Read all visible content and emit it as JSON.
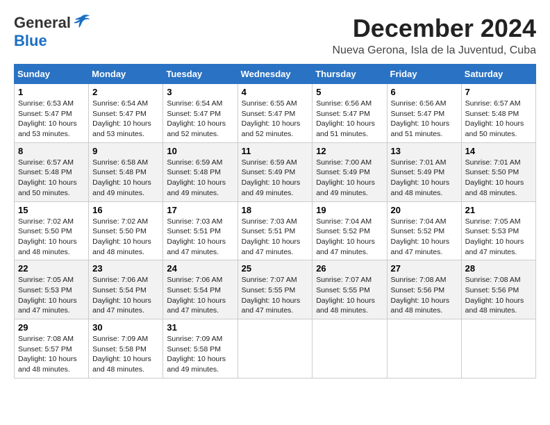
{
  "logo": {
    "general": "General",
    "blue": "Blue"
  },
  "title": "December 2024",
  "location": "Nueva Gerona, Isla de la Juventud, Cuba",
  "weekdays": [
    "Sunday",
    "Monday",
    "Tuesday",
    "Wednesday",
    "Thursday",
    "Friday",
    "Saturday"
  ],
  "weeks": [
    [
      {
        "day": "1",
        "sunrise": "6:53 AM",
        "sunset": "5:47 PM",
        "daylight": "10 hours and 53 minutes."
      },
      {
        "day": "2",
        "sunrise": "6:54 AM",
        "sunset": "5:47 PM",
        "daylight": "10 hours and 53 minutes."
      },
      {
        "day": "3",
        "sunrise": "6:54 AM",
        "sunset": "5:47 PM",
        "daylight": "10 hours and 52 minutes."
      },
      {
        "day": "4",
        "sunrise": "6:55 AM",
        "sunset": "5:47 PM",
        "daylight": "10 hours and 52 minutes."
      },
      {
        "day": "5",
        "sunrise": "6:56 AM",
        "sunset": "5:47 PM",
        "daylight": "10 hours and 51 minutes."
      },
      {
        "day": "6",
        "sunrise": "6:56 AM",
        "sunset": "5:47 PM",
        "daylight": "10 hours and 51 minutes."
      },
      {
        "day": "7",
        "sunrise": "6:57 AM",
        "sunset": "5:48 PM",
        "daylight": "10 hours and 50 minutes."
      }
    ],
    [
      {
        "day": "8",
        "sunrise": "6:57 AM",
        "sunset": "5:48 PM",
        "daylight": "10 hours and 50 minutes."
      },
      {
        "day": "9",
        "sunrise": "6:58 AM",
        "sunset": "5:48 PM",
        "daylight": "10 hours and 49 minutes."
      },
      {
        "day": "10",
        "sunrise": "6:59 AM",
        "sunset": "5:48 PM",
        "daylight": "10 hours and 49 minutes."
      },
      {
        "day": "11",
        "sunrise": "6:59 AM",
        "sunset": "5:49 PM",
        "daylight": "10 hours and 49 minutes."
      },
      {
        "day": "12",
        "sunrise": "7:00 AM",
        "sunset": "5:49 PM",
        "daylight": "10 hours and 49 minutes."
      },
      {
        "day": "13",
        "sunrise": "7:01 AM",
        "sunset": "5:49 PM",
        "daylight": "10 hours and 48 minutes."
      },
      {
        "day": "14",
        "sunrise": "7:01 AM",
        "sunset": "5:50 PM",
        "daylight": "10 hours and 48 minutes."
      }
    ],
    [
      {
        "day": "15",
        "sunrise": "7:02 AM",
        "sunset": "5:50 PM",
        "daylight": "10 hours and 48 minutes."
      },
      {
        "day": "16",
        "sunrise": "7:02 AM",
        "sunset": "5:50 PM",
        "daylight": "10 hours and 48 minutes."
      },
      {
        "day": "17",
        "sunrise": "7:03 AM",
        "sunset": "5:51 PM",
        "daylight": "10 hours and 47 minutes."
      },
      {
        "day": "18",
        "sunrise": "7:03 AM",
        "sunset": "5:51 PM",
        "daylight": "10 hours and 47 minutes."
      },
      {
        "day": "19",
        "sunrise": "7:04 AM",
        "sunset": "5:52 PM",
        "daylight": "10 hours and 47 minutes."
      },
      {
        "day": "20",
        "sunrise": "7:04 AM",
        "sunset": "5:52 PM",
        "daylight": "10 hours and 47 minutes."
      },
      {
        "day": "21",
        "sunrise": "7:05 AM",
        "sunset": "5:53 PM",
        "daylight": "10 hours and 47 minutes."
      }
    ],
    [
      {
        "day": "22",
        "sunrise": "7:05 AM",
        "sunset": "5:53 PM",
        "daylight": "10 hours and 47 minutes."
      },
      {
        "day": "23",
        "sunrise": "7:06 AM",
        "sunset": "5:54 PM",
        "daylight": "10 hours and 47 minutes."
      },
      {
        "day": "24",
        "sunrise": "7:06 AM",
        "sunset": "5:54 PM",
        "daylight": "10 hours and 47 minutes."
      },
      {
        "day": "25",
        "sunrise": "7:07 AM",
        "sunset": "5:55 PM",
        "daylight": "10 hours and 47 minutes."
      },
      {
        "day": "26",
        "sunrise": "7:07 AM",
        "sunset": "5:55 PM",
        "daylight": "10 hours and 48 minutes."
      },
      {
        "day": "27",
        "sunrise": "7:08 AM",
        "sunset": "5:56 PM",
        "daylight": "10 hours and 48 minutes."
      },
      {
        "day": "28",
        "sunrise": "7:08 AM",
        "sunset": "5:56 PM",
        "daylight": "10 hours and 48 minutes."
      }
    ],
    [
      {
        "day": "29",
        "sunrise": "7:08 AM",
        "sunset": "5:57 PM",
        "daylight": "10 hours and 48 minutes."
      },
      {
        "day": "30",
        "sunrise": "7:09 AM",
        "sunset": "5:58 PM",
        "daylight": "10 hours and 48 minutes."
      },
      {
        "day": "31",
        "sunrise": "7:09 AM",
        "sunset": "5:58 PM",
        "daylight": "10 hours and 49 minutes."
      },
      null,
      null,
      null,
      null
    ]
  ],
  "labels": {
    "sunrise": "Sunrise:",
    "sunset": "Sunset:",
    "daylight": "Daylight:"
  }
}
